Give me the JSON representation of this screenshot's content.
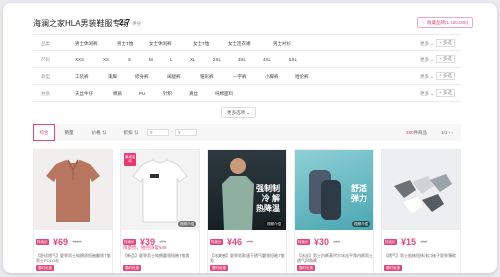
{
  "header": {
    "title": "海澜之家HLA男装鞋服专场",
    "rating": "2.7",
    "rating_sub": "评分",
    "fav_icon": "♡",
    "fav_label": "收藏品牌(1,420,000)"
  },
  "filters": {
    "rows": [
      {
        "label": "品类",
        "options": [
          "男士休闲裤",
          "男士T恤",
          "女士休闲裤",
          "女士T恤",
          "女士连衣裙",
          "男士衬衫"
        ]
      },
      {
        "label": "尺码",
        "options": [
          "XXS",
          "XS",
          "S",
          "M",
          "L",
          "XL",
          "2XL",
          "3XL",
          "4XL",
          "5XL"
        ]
      },
      {
        "label": "款型",
        "options": [
          "工装裤",
          "束脚",
          "修身裤",
          "阔腿裤",
          "锥形裤",
          "一字裤",
          "小脚裤",
          "哈伦裤"
        ]
      },
      {
        "label": "材质",
        "options": [
          "天丝牛仔",
          "棉质",
          "PU",
          "针织",
          "真丝",
          "纯棉面料"
        ]
      }
    ],
    "more_label": "更多 ⌄",
    "multi_label": "+ 多选",
    "expand_label": "更多选项 ⌄"
  },
  "sortbar": {
    "items": [
      "综合",
      "销量",
      "价格 ⇅",
      "折扣 ⇅"
    ],
    "price_min_placeholder": "¥",
    "price_max_placeholder": "¥",
    "dash": "-",
    "count_num": "280",
    "count_suffix": "件商品",
    "pager": "1/1 ‹ ›"
  },
  "products": [
    {
      "price_tag": "特卖价",
      "price": "¥69",
      "orig": "¥169",
      "extra": "",
      "desc": "【舒适透气】夏季男士纯棉质短袖翻领T恤男士POLO衫",
      "badge": "限时优惠",
      "video": "",
      "promo": ""
    },
    {
      "price_tag": "特卖价",
      "price": "¥39",
      "orig": "¥79",
      "extra": "限量抢，拍完恢复¥48",
      "desc": "【新品】夏季男士纯棉圆领短袖T恤男",
      "badge": "限时优惠",
      "video": "视频介绍",
      "promo": "满减活动"
    },
    {
      "price_tag": "特卖价",
      "price": "¥46",
      "orig": "¥99",
      "extra": "",
      "desc": "【冰爽感】夏季男款速干透气圆领短袖T恤男",
      "badge": "限时优惠",
      "video": "视频介绍",
      "promo": "",
      "ad_text": "强制制冷 解热降温"
    },
    {
      "price_tag": "特卖价",
      "price": "¥30",
      "orig": "¥69",
      "extra": "",
      "desc": "【冰丝】男士内裤莫代尔冰丝平角内裤男士透气四角裤",
      "badge": "限时优惠",
      "video": "视频介绍",
      "promo": "",
      "ad_text": "舒适 弹力"
    },
    {
      "price_tag": "特卖价",
      "price": "¥15",
      "orig": "¥32",
      "extra": "",
      "desc": "【透气】男士船袜短袜浅口袜子夏季薄款",
      "badge": "限时优惠",
      "video": "",
      "promo": ""
    }
  ],
  "colors": {
    "accent": "#e0487a",
    "background": "#e9e9ee"
  }
}
